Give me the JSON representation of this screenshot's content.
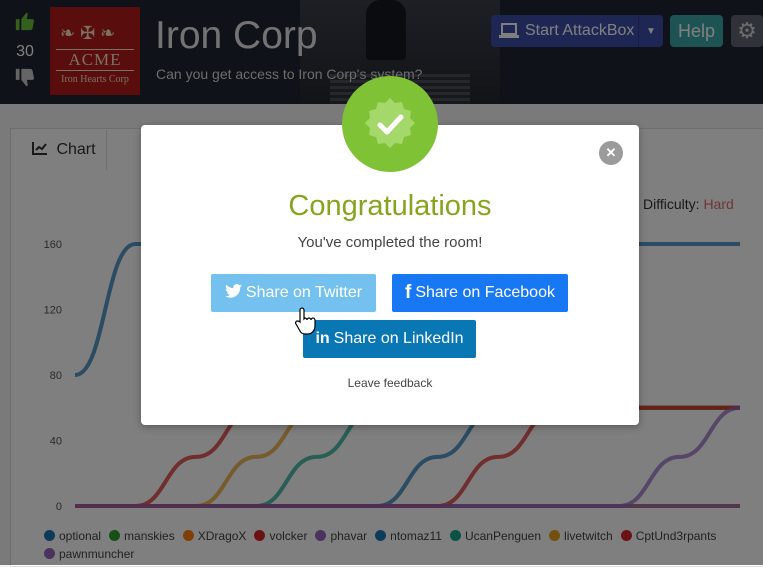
{
  "room": {
    "title": "Iron Corp",
    "subtitle": "Can you get access to Iron Corp's system?",
    "votes": "30",
    "logo_text": "ACME",
    "logo_subtext": "Iron Hearts Corp"
  },
  "header": {
    "attackbox_label": "Start AttackBox",
    "help_label": "Help"
  },
  "tabs": {
    "chart_label": "Chart"
  },
  "difficulty": {
    "label": "Difficulty:",
    "value": "Hard"
  },
  "chart_data": {
    "type": "line",
    "ylim": [
      0,
      160
    ],
    "yticks": [
      "0",
      "40",
      "80",
      "120",
      "160"
    ],
    "grid": false,
    "legend_position": "bottom",
    "series": [
      {
        "name": "optional",
        "color": "#1f77b4",
        "values": [
          80,
          160,
          160,
          160,
          160,
          160,
          160,
          160,
          160,
          160,
          160,
          160
        ]
      },
      {
        "name": "manskies",
        "color": "#2ca02c",
        "values": [
          0,
          0,
          0,
          0,
          0,
          0,
          0,
          0,
          0,
          0,
          0,
          0
        ]
      },
      {
        "name": "XDragoX",
        "color": "#ff7f0e",
        "values": [
          0,
          0,
          0,
          0,
          0,
          0,
          0,
          0,
          0,
          0,
          0,
          0
        ]
      },
      {
        "name": "volcker",
        "color": "#d62728",
        "values": [
          0,
          0,
          30,
          60,
          60,
          60,
          60,
          60,
          60,
          60,
          60,
          60
        ]
      },
      {
        "name": "phavar",
        "color": "#9467bd",
        "values": [
          0,
          0,
          0,
          0,
          0,
          0,
          0,
          0,
          0,
          0,
          0,
          0
        ]
      },
      {
        "name": "ntomaz11",
        "color": "#1f77b4",
        "values": [
          0,
          0,
          0,
          0,
          0,
          0,
          30,
          60,
          60,
          60,
          60,
          60
        ]
      },
      {
        "name": "UcanPenguen",
        "color": "#17a589",
        "values": [
          0,
          0,
          0,
          0,
          30,
          60,
          60,
          60,
          60,
          60,
          60,
          60
        ]
      },
      {
        "name": "livetwitch",
        "color": "#e6a020",
        "values": [
          0,
          0,
          0,
          30,
          60,
          60,
          60,
          60,
          60,
          60,
          60,
          60
        ]
      },
      {
        "name": "CptUnd3rpants",
        "color": "#d62728",
        "values": [
          0,
          0,
          0,
          0,
          0,
          0,
          0,
          30,
          60,
          60,
          60,
          60
        ]
      },
      {
        "name": "pawnmuncher",
        "color": "#9467bd",
        "values": [
          0,
          0,
          0,
          0,
          0,
          0,
          0,
          0,
          0,
          0,
          30,
          60
        ]
      }
    ]
  },
  "modal": {
    "title": "Congratulations",
    "message": "You've completed the room!",
    "twitter_label": "Share on Twitter",
    "facebook_label": "Share on Facebook",
    "linkedin_label": "Share on LinkedIn",
    "feedback_label": "Leave feedback"
  },
  "icons": [
    "thumbs-up-icon",
    "thumbs-down-icon",
    "laptop-icon",
    "gear-icon",
    "chart-line-icon",
    "checkmark-icon",
    "close-icon",
    "twitter-icon",
    "facebook-icon",
    "linkedin-icon",
    "hand-cursor-icon"
  ]
}
